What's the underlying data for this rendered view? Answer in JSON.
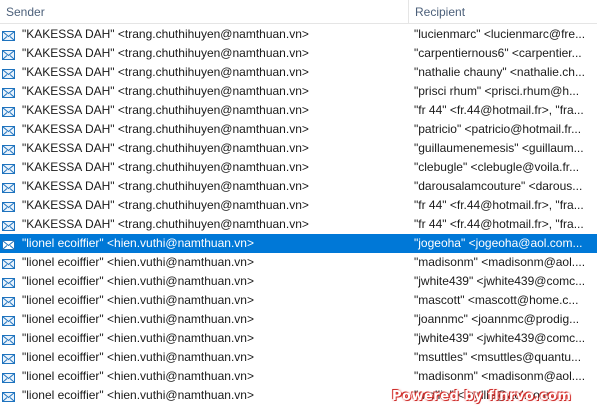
{
  "columns": {
    "sender": "Sender",
    "recipient": "Recipient"
  },
  "rows": [
    {
      "sender": "\"KAKESSA DAH\" <trang.chuthihuyen@namthuan.vn>",
      "recipient": "\"lucienmarc\" <lucienmarc@fre...",
      "selected": false
    },
    {
      "sender": "\"KAKESSA DAH\" <trang.chuthihuyen@namthuan.vn>",
      "recipient": "\"carpentiernous6\" <carpentier...",
      "selected": false
    },
    {
      "sender": "\"KAKESSA DAH\" <trang.chuthihuyen@namthuan.vn>",
      "recipient": "\"nathalie chauny\" <nathalie.ch...",
      "selected": false
    },
    {
      "sender": "\"KAKESSA DAH\" <trang.chuthihuyen@namthuan.vn>",
      "recipient": "\"prisci rhum\" <prisci.rhum@h...",
      "selected": false
    },
    {
      "sender": "\"KAKESSA DAH\" <trang.chuthihuyen@namthuan.vn>",
      "recipient": "\"fr 44\" <fr.44@hotmail.fr>, \"fra...",
      "selected": false
    },
    {
      "sender": "\"KAKESSA DAH\" <trang.chuthihuyen@namthuan.vn>",
      "recipient": "\"patricio\" <patricio@hotmail.fr...",
      "selected": false
    },
    {
      "sender": "\"KAKESSA DAH\" <trang.chuthihuyen@namthuan.vn>",
      "recipient": "\"guillaumenemesis\" <guillaum...",
      "selected": false
    },
    {
      "sender": "\"KAKESSA DAH\" <trang.chuthihuyen@namthuan.vn>",
      "recipient": "\"clebugle\" <clebugle@voila.fr...",
      "selected": false
    },
    {
      "sender": "\"KAKESSA DAH\" <trang.chuthihuyen@namthuan.vn>",
      "recipient": "\"darousalamcouture\" <darous...",
      "selected": false
    },
    {
      "sender": "\"KAKESSA DAH\" <trang.chuthihuyen@namthuan.vn>",
      "recipient": "\"fr 44\" <fr.44@hotmail.fr>, \"fra...",
      "selected": false
    },
    {
      "sender": "\"KAKESSA DAH\" <trang.chuthihuyen@namthuan.vn>",
      "recipient": "\"fr 44\" <fr.44@hotmail.fr>, \"fra...",
      "selected": false
    },
    {
      "sender": "\"lionel ecoiffier\" <hien.vuthi@namthuan.vn>",
      "recipient": "\"jogeoha\" <jogeoha@aol.com...",
      "selected": true
    },
    {
      "sender": "\"lionel ecoiffier\" <hien.vuthi@namthuan.vn>",
      "recipient": "\"madisonm\" <madisonm@aol....",
      "selected": false
    },
    {
      "sender": "\"lionel ecoiffier\" <hien.vuthi@namthuan.vn>",
      "recipient": "\"jwhite439\" <jwhite439@comc...",
      "selected": false
    },
    {
      "sender": "\"lionel ecoiffier\" <hien.vuthi@namthuan.vn>",
      "recipient": "\"mascott\" <mascott@home.c...",
      "selected": false
    },
    {
      "sender": "\"lionel ecoiffier\" <hien.vuthi@namthuan.vn>",
      "recipient": "\"joannmc\" <joannmc@prodig...",
      "selected": false
    },
    {
      "sender": "\"lionel ecoiffier\" <hien.vuthi@namthuan.vn>",
      "recipient": "\"jwhite439\" <jwhite439@comc...",
      "selected": false
    },
    {
      "sender": "\"lionel ecoiffier\" <hien.vuthi@namthuan.vn>",
      "recipient": "\"msuttles\" <msuttles@quantu...",
      "selected": false
    },
    {
      "sender": "\"lionel ecoiffier\" <hien.vuthi@namthuan.vn>",
      "recipient": "\"madisonm\" <madisonm@aol....",
      "selected": false
    },
    {
      "sender": "\"lionel ecoiffier\" <hien.vuthi@namthuan.vn>",
      "recipient": "\"mollie\" <mollie@aol.com>...",
      "selected": false
    }
  ],
  "row_icon": "envelope-icon",
  "watermark": "Powered by flnrvo.com",
  "colors": {
    "selection": "#0078d7",
    "header_text": "#4c607a",
    "icon": "#1e73be"
  }
}
